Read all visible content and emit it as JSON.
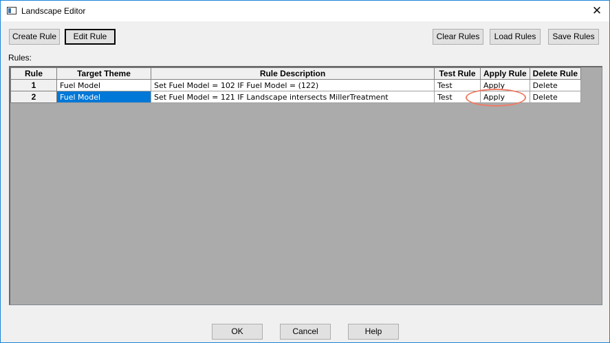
{
  "window": {
    "title": "Landscape Editor",
    "close_glyph": "✕"
  },
  "toolbar": {
    "create_rule": "Create Rule",
    "edit_rule": "Edit Rule",
    "clear_rules": "Clear Rules",
    "load_rules": "Load Rules",
    "save_rules": "Save Rules"
  },
  "rules_label": "Rules:",
  "grid": {
    "headers": [
      "Rule",
      "Target Theme",
      "Rule Description",
      "Test Rule",
      "Apply Rule",
      "Delete Rule"
    ],
    "rows": [
      {
        "rule": "1",
        "target_theme": "Fuel Model",
        "description": "Set Fuel Model = 102 IF Fuel Model = (122)",
        "test": "Test",
        "apply": "Apply",
        "delete": "Delete"
      },
      {
        "rule": "2",
        "target_theme": "Fuel Model",
        "description": "Set Fuel Model = 121 IF Landscape intersects MillerTreatment",
        "test": "Test",
        "apply": "Apply",
        "delete": "Delete"
      }
    ]
  },
  "footer": {
    "ok": "OK",
    "cancel": "Cancel",
    "help": "Help"
  },
  "colors": {
    "selection": "#0078d7",
    "annotation": "#ef7c66",
    "border_accent": "#1883d7"
  }
}
